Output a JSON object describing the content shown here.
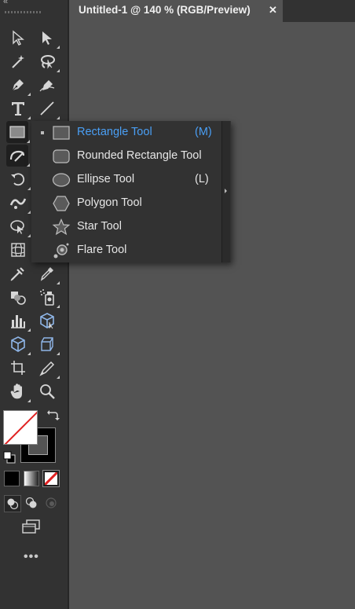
{
  "document_tab": {
    "title": "Untitled-1 @ 140 % (RGB/Preview)",
    "close_glyph": "✕"
  },
  "toolbar": {
    "collapse_glyph": "«",
    "more_glyph": "•••",
    "tools": [
      {
        "name": "selection-tool",
        "icon": "arrow-outline-icon"
      },
      {
        "name": "direct-selection-tool",
        "icon": "arrow-filled-icon"
      },
      {
        "name": "magic-wand-tool",
        "icon": "magic-wand-icon"
      },
      {
        "name": "lasso-tool",
        "icon": "lasso-icon"
      },
      {
        "name": "pen-tool",
        "icon": "pen-icon"
      },
      {
        "name": "curvature-tool",
        "icon": "curvature-pen-icon"
      },
      {
        "name": "type-tool",
        "icon": "type-icon"
      },
      {
        "name": "line-segment-tool",
        "icon": "line-icon"
      },
      {
        "name": "rectangle-tool",
        "icon": "rectangle-icon",
        "active": true
      },
      {
        "name": "shaper-tool",
        "icon": "shaper-icon",
        "active": true
      },
      {
        "name": "rotate-tool",
        "icon": "rotate-icon"
      },
      {
        "name": "width-tool",
        "icon": "width-icon"
      },
      {
        "name": "free-transform-tool",
        "icon": "free-transform-icon"
      },
      {
        "name": "perspective-grid-tool",
        "icon": "perspective-grid-icon"
      },
      {
        "name": "mesh-tool",
        "icon": "mesh-icon"
      },
      {
        "name": "gradient-tool",
        "icon": "gradient-icon"
      },
      {
        "name": "eyedropper-tool",
        "icon": "eyedropper-icon"
      },
      {
        "name": "blend-tool",
        "icon": "blend-icon"
      },
      {
        "name": "symbol-sprayer-tool",
        "icon": "symbol-sprayer-icon"
      },
      {
        "name": "column-graph-tool",
        "icon": "column-graph-icon"
      },
      {
        "name": "3d-tool",
        "icon": "3d-cube-icon"
      },
      {
        "name": "3d-rotate-tool",
        "icon": "3d-cube-outline-icon"
      },
      {
        "name": "artboard-tool",
        "icon": "artboard-icon"
      },
      {
        "name": "slice-tool",
        "icon": "knife-icon"
      },
      {
        "name": "hand-tool",
        "icon": "hand-icon"
      },
      {
        "name": "zoom-tool",
        "icon": "magnifier-icon"
      }
    ],
    "fill_color": "#ffffff",
    "stroke_color": "#000000",
    "none_slash_color": "#e02020"
  },
  "flyout": {
    "items": [
      {
        "label": "Rectangle Tool",
        "shortcut": "(M)",
        "icon": "rectangle-icon",
        "selected": true
      },
      {
        "label": "Rounded Rectangle Tool",
        "shortcut": "",
        "icon": "rounded-rectangle-icon",
        "selected": false
      },
      {
        "label": "Ellipse Tool",
        "shortcut": "(L)",
        "icon": "ellipse-icon",
        "selected": false
      },
      {
        "label": "Polygon Tool",
        "shortcut": "",
        "icon": "polygon-icon",
        "selected": false
      },
      {
        "label": "Star Tool",
        "shortcut": "",
        "icon": "star-icon",
        "selected": false
      },
      {
        "label": "Flare Tool",
        "shortcut": "",
        "icon": "flare-icon",
        "selected": false
      }
    ],
    "selected_color": "#4a9ff5"
  }
}
